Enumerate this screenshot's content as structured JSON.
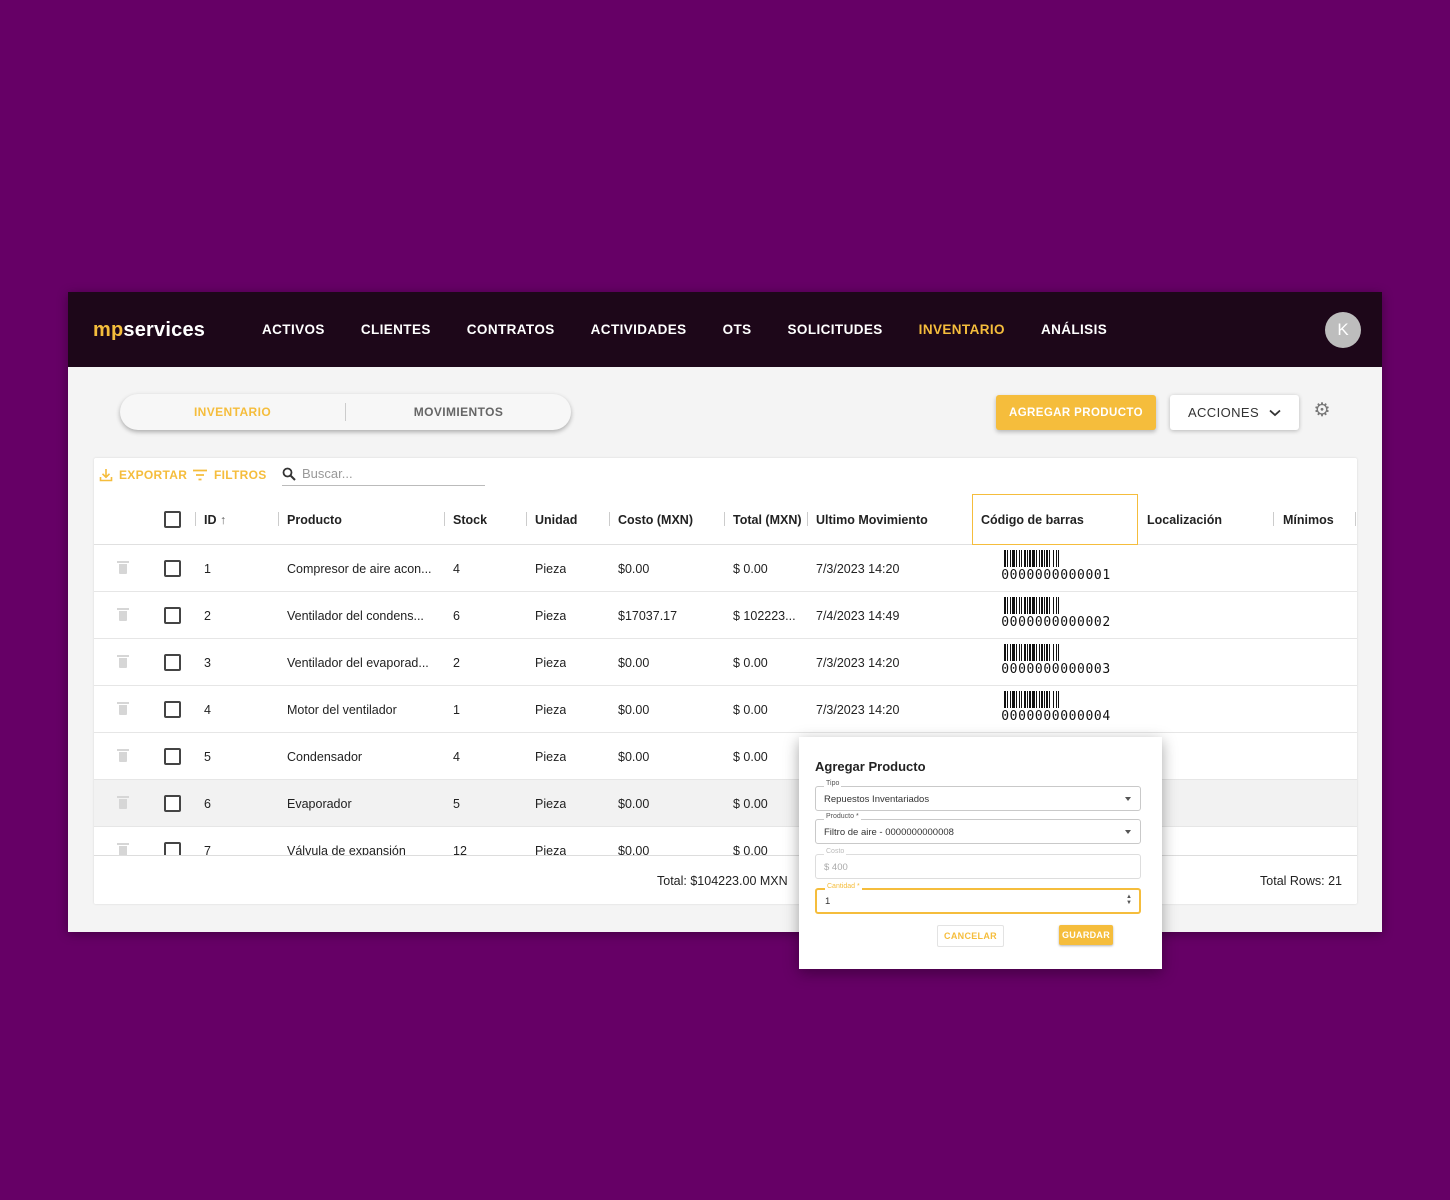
{
  "app": {
    "logo_prefix": "mp",
    "logo_suffix": "services",
    "avatar_initial": "K"
  },
  "nav": [
    "ACTIVOS",
    "CLIENTES",
    "CONTRATOS",
    "ACTIVIDADES",
    "OTS",
    "SOLICITUDES",
    "INVENTARIO",
    "ANÁLISIS"
  ],
  "nav_active": "INVENTARIO",
  "tabs": {
    "inventario": "INVENTARIO",
    "movimientos": "MOVIMIENTOS",
    "active": "inventario"
  },
  "actions": {
    "add_label": "AGREGAR PRODUCTO",
    "acciones_label": "ACCIONES"
  },
  "toolbar": {
    "export_label": "EXPORTAR",
    "filters_label": "FILTROS",
    "search_placeholder": "Buscar..."
  },
  "columns": {
    "id": "ID",
    "producto": "Producto",
    "stock": "Stock",
    "unidad": "Unidad",
    "costo": "Costo (MXN)",
    "total": "Total (MXN)",
    "ultimo": "Ultimo Movimiento",
    "codigo": "Código de barras",
    "localizacion": "Localización",
    "minimos": "Mínimos"
  },
  "rows": [
    {
      "id": "1",
      "producto": "Compresor de aire acon...",
      "stock": "4",
      "unidad": "Pieza",
      "costo": "$0.00",
      "total": "$ 0.00",
      "ultimo": "7/3/2023 14:20",
      "barcode": "0000000000001"
    },
    {
      "id": "2",
      "producto": "Ventilador del condens...",
      "stock": "6",
      "unidad": "Pieza",
      "costo": "$17037.17",
      "total": "$ 102223...",
      "ultimo": "7/4/2023 14:49",
      "barcode": "0000000000002"
    },
    {
      "id": "3",
      "producto": "Ventilador del evaporad...",
      "stock": "2",
      "unidad": "Pieza",
      "costo": "$0.00",
      "total": "$ 0.00",
      "ultimo": "7/3/2023 14:20",
      "barcode": "0000000000003"
    },
    {
      "id": "4",
      "producto": "Motor del ventilador",
      "stock": "1",
      "unidad": "Pieza",
      "costo": "$0.00",
      "total": "$ 0.00",
      "ultimo": "7/3/2023 14:20",
      "barcode": "0000000000004"
    },
    {
      "id": "5",
      "producto": "Condensador",
      "stock": "4",
      "unidad": "Pieza",
      "costo": "$0.00",
      "total": "$ 0.00",
      "ultimo": "",
      "barcode": ""
    },
    {
      "id": "6",
      "producto": "Evaporador",
      "stock": "5",
      "unidad": "Pieza",
      "costo": "$0.00",
      "total": "$ 0.00",
      "ultimo": "",
      "barcode": ""
    },
    {
      "id": "7",
      "producto": "Válvula de expansión",
      "stock": "12",
      "unidad": "Pieza",
      "costo": "$0.00",
      "total": "$ 0.00",
      "ultimo": "",
      "barcode": ""
    }
  ],
  "footer": {
    "total": "Total: $104223.00 MXN",
    "rows_total": "Total Rows: 21"
  },
  "dialog": {
    "title": "Agregar Producto",
    "tipo_label": "Tipo",
    "tipo_value": "Repuestos Inventariados",
    "producto_label": "Producto *",
    "producto_value": "Filtro de aire - 0000000000008",
    "costo_label": "Costo",
    "costo_value": "$  400",
    "cantidad_label": "Cantidad *",
    "cantidad_value": "1",
    "cancel_label": "CANCELAR",
    "save_label": "GUARDAR"
  },
  "colors": {
    "accent": "#f5bd3c",
    "topbar": "#1d0719",
    "background": "#660066"
  }
}
